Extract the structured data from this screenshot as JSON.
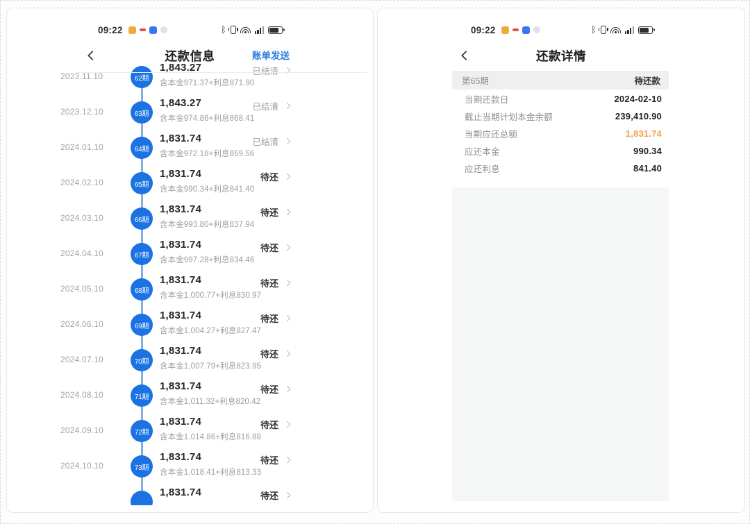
{
  "colors": {
    "accent_blue": "#1a72e3",
    "link_blue": "#2b7de0",
    "timeline_blue": "#85aede",
    "highlight_orange": "#f0a24b",
    "settled_gray": "#9e9e9e",
    "pending_dark": "#333333"
  },
  "left_screen": {
    "status_bar": {
      "time": "09:22",
      "app_icons": [
        "orange-app-icon",
        "red-app-icon",
        "blue-app-icon",
        "shield-app-icon"
      ],
      "system_icons": [
        "bluetooth-icon",
        "vibrate-icon",
        "wifi-icon",
        "signal-icon",
        "battery-icon"
      ]
    },
    "header": {
      "title": "还款信息",
      "action": "账单发送"
    },
    "rows": [
      {
        "date": "2023.11.10",
        "period": "62期",
        "amount": "1,843.27",
        "detail": "含本金971.37+利息871.90",
        "status": "已结清",
        "settled": true,
        "partial": false
      },
      {
        "date": "2023.12.10",
        "period": "63期",
        "amount": "1,843.27",
        "detail": "含本金974.86+利息868.41",
        "status": "已结清",
        "settled": true,
        "partial": false
      },
      {
        "date": "2024.01.10",
        "period": "64期",
        "amount": "1,831.74",
        "detail": "含本金972.18+利息859.56",
        "status": "已结清",
        "settled": true,
        "partial": false
      },
      {
        "date": "2024.02.10",
        "period": "65期",
        "amount": "1,831.74",
        "detail": "含本金990.34+利息841.40",
        "status": "待还",
        "settled": false,
        "partial": false
      },
      {
        "date": "2024.03.10",
        "period": "66期",
        "amount": "1,831.74",
        "detail": "含本金993.80+利息837.94",
        "status": "待还",
        "settled": false,
        "partial": false
      },
      {
        "date": "2024.04.10",
        "period": "67期",
        "amount": "1,831.74",
        "detail": "含本金997.28+利息834.46",
        "status": "待还",
        "settled": false,
        "partial": false
      },
      {
        "date": "2024.05.10",
        "period": "68期",
        "amount": "1,831.74",
        "detail": "含本金1,000.77+利息830.97",
        "status": "待还",
        "settled": false,
        "partial": false
      },
      {
        "date": "2024.06.10",
        "period": "69期",
        "amount": "1,831.74",
        "detail": "含本金1,004.27+利息827.47",
        "status": "待还",
        "settled": false,
        "partial": false
      },
      {
        "date": "2024.07.10",
        "period": "70期",
        "amount": "1,831.74",
        "detail": "含本金1,007.79+利息823.95",
        "status": "待还",
        "settled": false,
        "partial": false
      },
      {
        "date": "2024.08.10",
        "period": "71期",
        "amount": "1,831.74",
        "detail": "含本金1,011.32+利息820.42",
        "status": "待还",
        "settled": false,
        "partial": false
      },
      {
        "date": "2024.09.10",
        "period": "72期",
        "amount": "1,831.74",
        "detail": "含本金1,014.86+利息816.88",
        "status": "待还",
        "settled": false,
        "partial": false
      },
      {
        "date": "2024.10.10",
        "period": "73期",
        "amount": "1,831.74",
        "detail": "含本金1,018.41+利息813.33",
        "status": "待还",
        "settled": false,
        "partial": false
      },
      {
        "date": "",
        "period": "",
        "amount": "1,831.74",
        "detail": "",
        "status": "待还",
        "settled": false,
        "partial": true
      }
    ]
  },
  "right_screen": {
    "status_bar": {
      "time": "09:22",
      "app_icons": [
        "orange-app-icon",
        "red-app-icon",
        "blue-app-icon",
        "shield-app-icon"
      ],
      "system_icons": [
        "bluetooth-icon",
        "vibrate-icon",
        "wifi-icon",
        "signal-icon",
        "battery-icon"
      ]
    },
    "header": {
      "title": "还款详情"
    },
    "period_bar": {
      "label": "第65期",
      "status": "待还款"
    },
    "details": [
      {
        "label": "当期还款日",
        "value": "2024-02-10",
        "highlight": false
      },
      {
        "label": "截止当期计划本金余额",
        "value": "239,410.90",
        "highlight": false
      },
      {
        "label": "当期应还总额",
        "value": "1,831.74",
        "highlight": true
      },
      {
        "label": "应还本金",
        "value": "990.34",
        "highlight": false
      },
      {
        "label": "应还利息",
        "value": "841.40",
        "highlight": false
      }
    ]
  }
}
